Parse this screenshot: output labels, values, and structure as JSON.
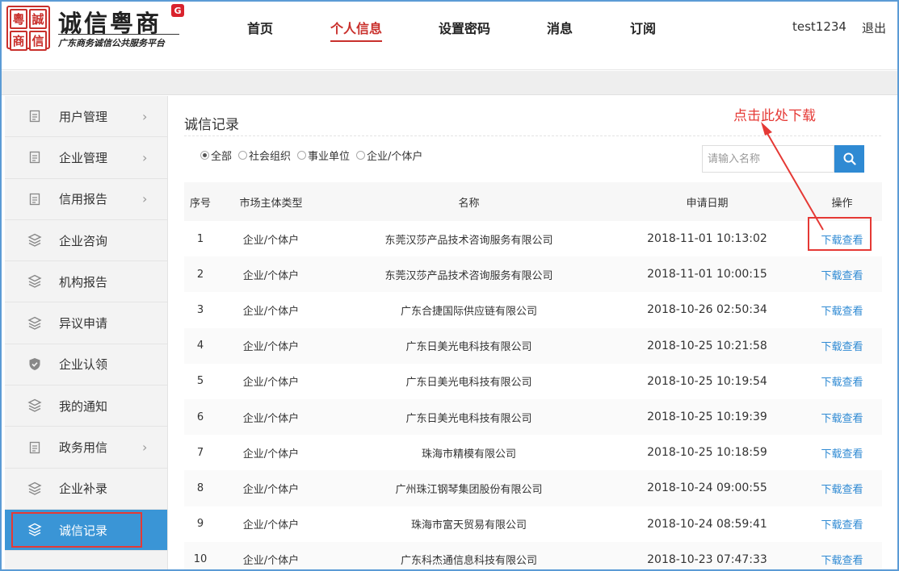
{
  "logo": {
    "seal_chars": [
      "粵",
      "誠",
      "商",
      "信"
    ],
    "title": "诚信粤商",
    "badge": "G",
    "subtitle": "广东商务诚信公共服务平台"
  },
  "nav": {
    "items": [
      "首页",
      "个人信息",
      "设置密码",
      "消息",
      "订阅"
    ],
    "active": "个人信息"
  },
  "user": {
    "name": "test1234",
    "logout": "退出"
  },
  "sidebar": {
    "items": [
      {
        "label": "用户管理",
        "icon": "document-icon",
        "chevron": true
      },
      {
        "label": "企业管理",
        "icon": "document-icon",
        "chevron": true
      },
      {
        "label": "信用报告",
        "icon": "document-icon",
        "chevron": true
      },
      {
        "label": "企业咨询",
        "icon": "layers-icon",
        "chevron": false
      },
      {
        "label": "机构报告",
        "icon": "layers-icon",
        "chevron": false
      },
      {
        "label": "异议申请",
        "icon": "layers-icon",
        "chevron": false
      },
      {
        "label": "企业认领",
        "icon": "shield-icon",
        "chevron": false
      },
      {
        "label": "我的通知",
        "icon": "layers-icon",
        "chevron": false
      },
      {
        "label": "政务用信",
        "icon": "document-icon",
        "chevron": true
      },
      {
        "label": "企业补录",
        "icon": "layers-icon",
        "chevron": false
      },
      {
        "label": "诚信记录",
        "icon": "layers-icon",
        "chevron": false,
        "active": true
      }
    ]
  },
  "main": {
    "title": "诚信记录",
    "filters": [
      {
        "label": "全部",
        "checked": true
      },
      {
        "label": "社会组织",
        "checked": false
      },
      {
        "label": "事业单位",
        "checked": false
      },
      {
        "label": "企业/个体户",
        "checked": false
      }
    ],
    "search_placeholder": "请输入名称",
    "table": {
      "headers": [
        "序号",
        "市场主体类型",
        "名称",
        "申请日期",
        "操作"
      ],
      "rows": [
        [
          "1",
          "企业/个体户",
          "东莞汉莎产品技术咨询服务有限公司",
          "2018-11-01 10:13:02",
          "下载查看"
        ],
        [
          "2",
          "企业/个体户",
          "东莞汉莎产品技术咨询服务有限公司",
          "2018-11-01 10:00:15",
          "下载查看"
        ],
        [
          "3",
          "企业/个体户",
          "广东合捷国际供应链有限公司",
          "2018-10-26 02:50:34",
          "下载查看"
        ],
        [
          "4",
          "企业/个体户",
          "广东日美光电科技有限公司",
          "2018-10-25 10:21:58",
          "下载查看"
        ],
        [
          "5",
          "企业/个体户",
          "广东日美光电科技有限公司",
          "2018-10-25 10:19:54",
          "下载查看"
        ],
        [
          "6",
          "企业/个体户",
          "广东日美光电科技有限公司",
          "2018-10-25 10:19:39",
          "下载查看"
        ],
        [
          "7",
          "企业/个体户",
          "珠海市精模有限公司",
          "2018-10-25 10:18:59",
          "下载查看"
        ],
        [
          "8",
          "企业/个体户",
          "广州珠江钢琴集团股份有限公司",
          "2018-10-24 09:00:55",
          "下载查看"
        ],
        [
          "9",
          "企业/个体户",
          "珠海市富天贸易有限公司",
          "2018-10-24 08:59:41",
          "下载查看"
        ],
        [
          "10",
          "企业/个体户",
          "广东科杰通信息科技有限公司",
          "2018-10-23 07:47:33",
          "下载查看"
        ]
      ]
    }
  },
  "annotation": {
    "text": "点击此处下载",
    "color": "#e53935"
  },
  "colors": {
    "brand_red": "#c9302c",
    "accent_blue": "#2f8ad3",
    "sidebar_active": "#3a95d6"
  }
}
